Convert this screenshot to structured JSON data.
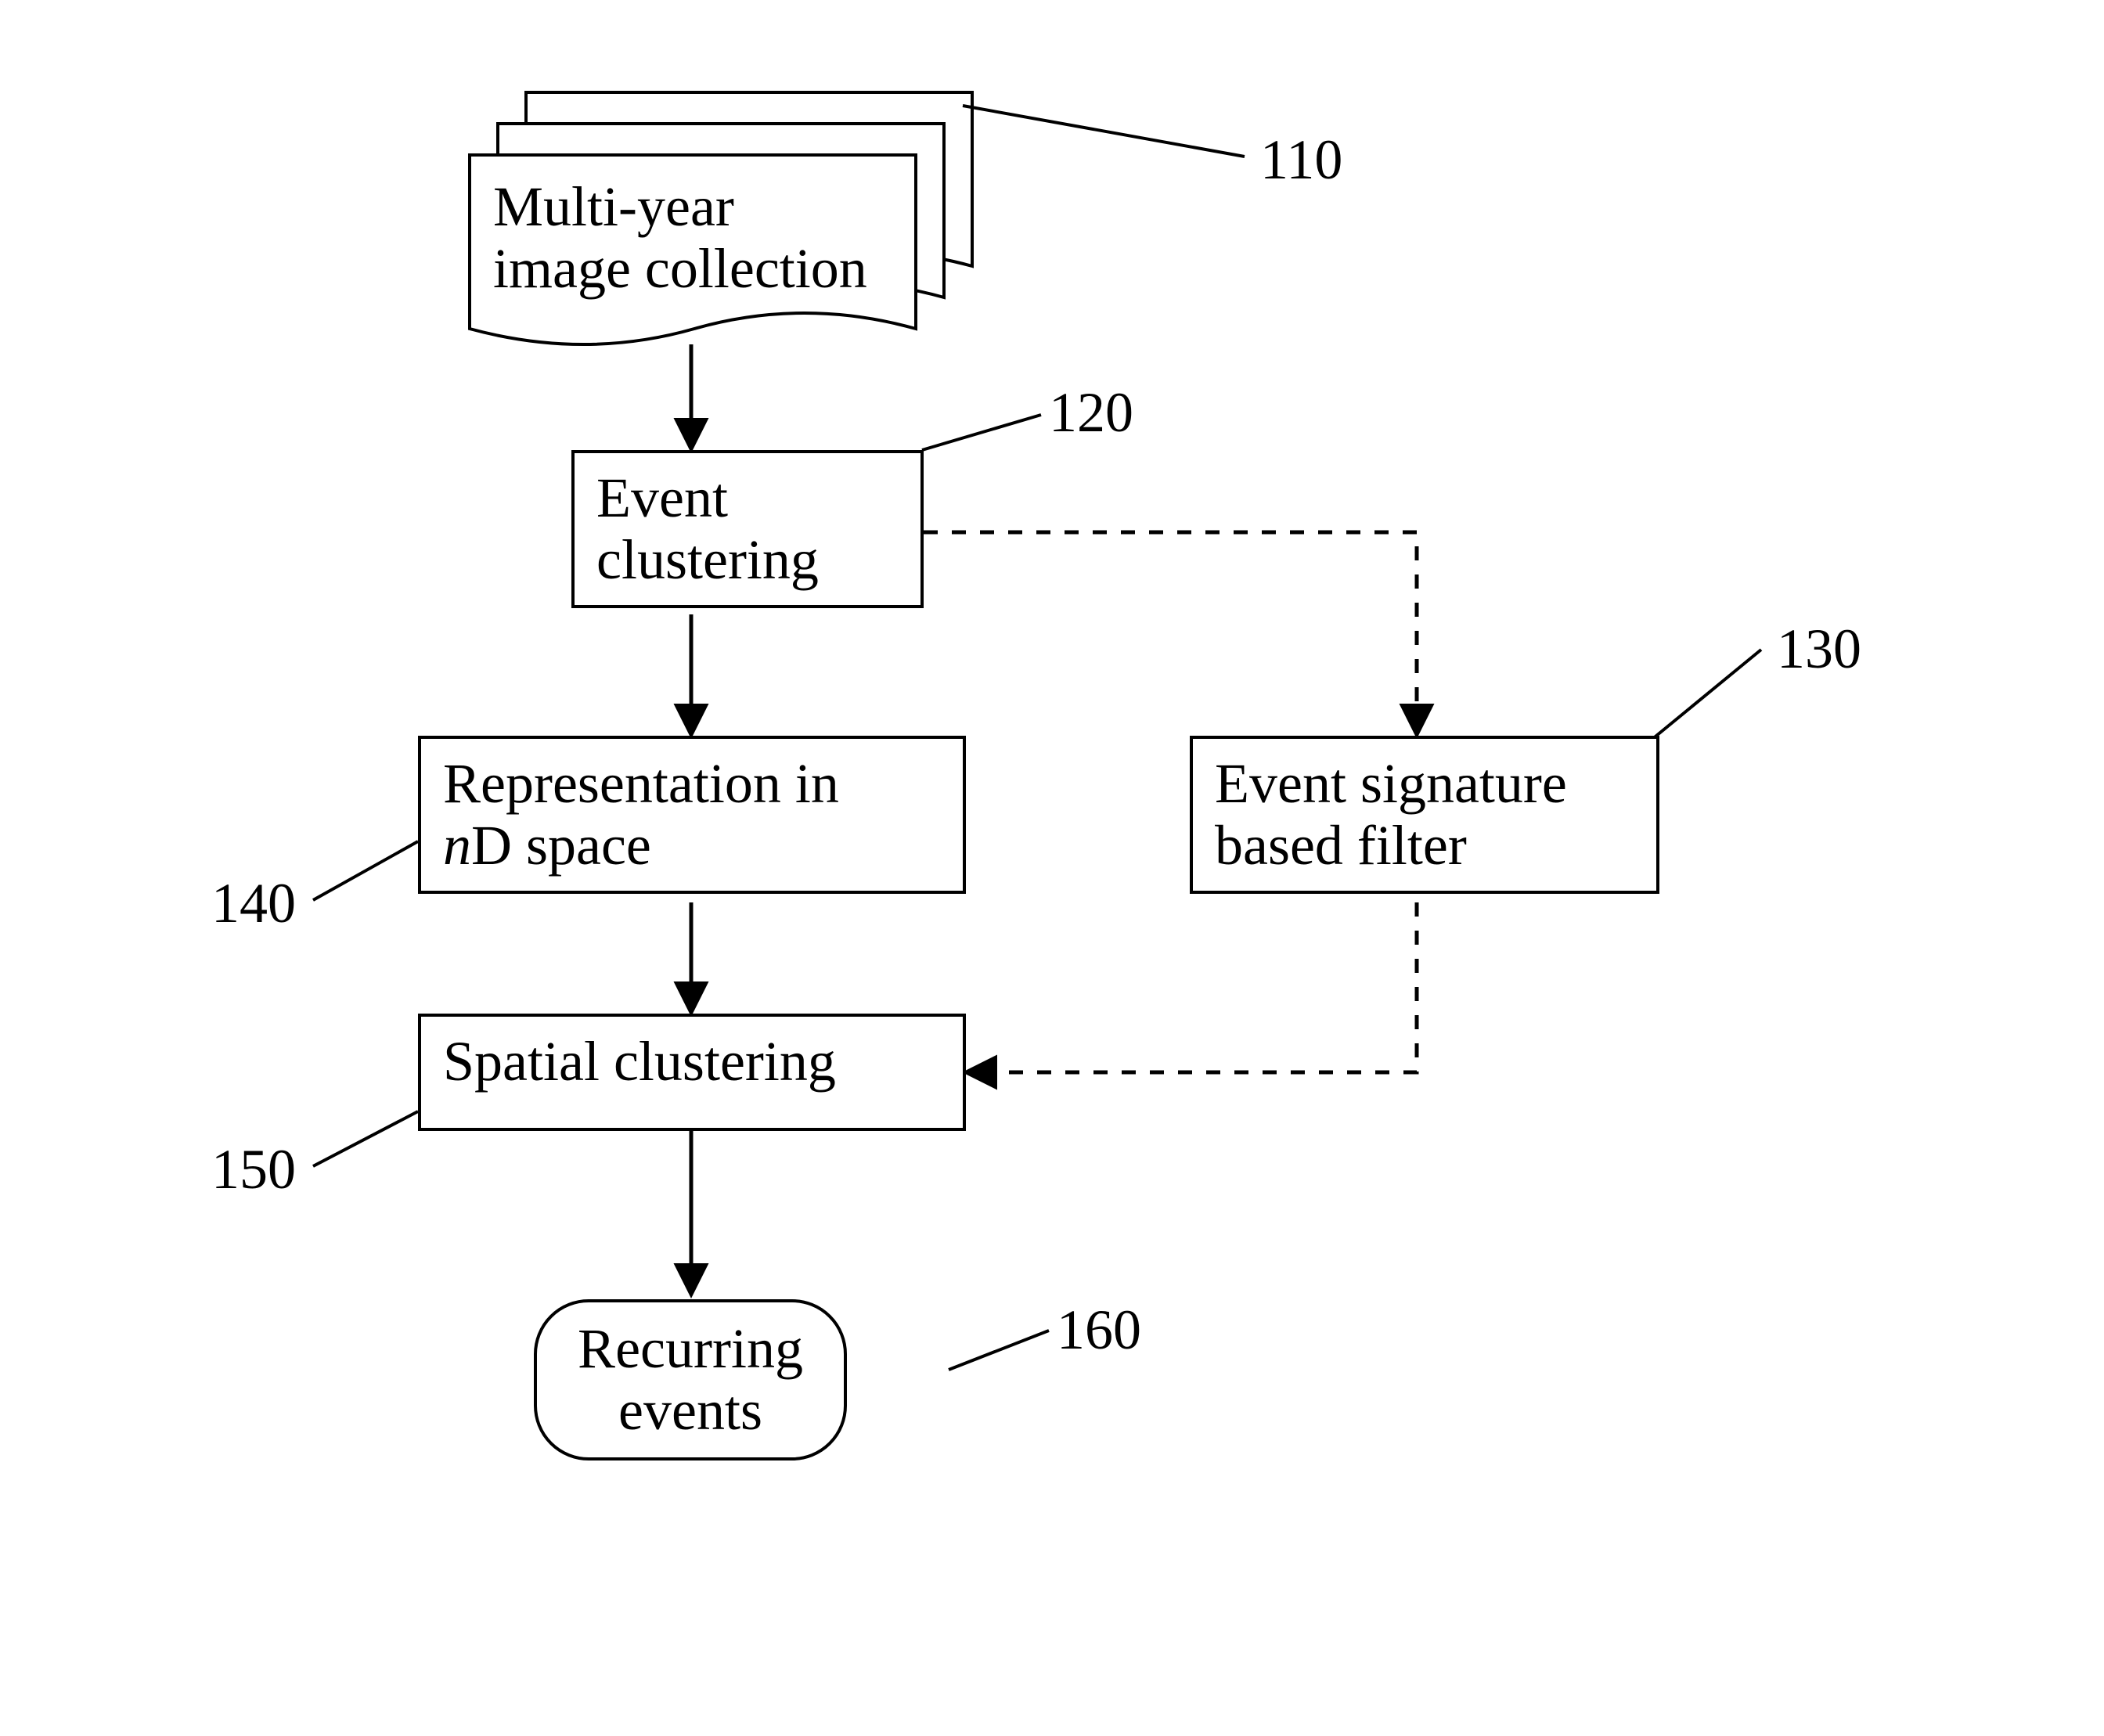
{
  "nodes": {
    "input": {
      "ref": "110",
      "text_line1": "Multi-year",
      "text_line2": "image collection"
    },
    "event_clustering": {
      "ref": "120",
      "text_line1": "Event",
      "text_line2": "clustering"
    },
    "signature_filter": {
      "ref": "130",
      "text_line1": "Event signature",
      "text_line2": "based filter"
    },
    "representation": {
      "ref": "140",
      "text_line1": "Representation in",
      "text_line2_prefix": "n",
      "text_line2_suffix": "D space"
    },
    "spatial_clustering": {
      "ref": "150",
      "text_line1": "Spatial clustering"
    },
    "recurring": {
      "ref": "160",
      "text_line1": "Recurring",
      "text_line2": "events"
    }
  }
}
